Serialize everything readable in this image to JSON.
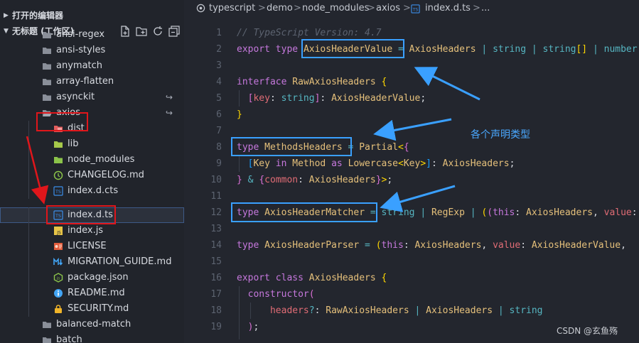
{
  "sidebar": {
    "open_editors_label": "打开的编辑器",
    "workspace_label": "无标题 (工作区)",
    "tree": [
      {
        "label": "ansi-regex",
        "kind": "folder",
        "badge": ""
      },
      {
        "label": "ansi-styles",
        "kind": "folder",
        "badge": ""
      },
      {
        "label": "anymatch",
        "kind": "folder",
        "badge": ""
      },
      {
        "label": "array-flatten",
        "kind": "folder",
        "badge": ""
      },
      {
        "label": "asynckit",
        "kind": "folder",
        "badge": "↪"
      },
      {
        "label": "axios",
        "kind": "folder-open",
        "badge": "↪"
      },
      {
        "label": "dist",
        "kind": "folder-red",
        "badge": ""
      },
      {
        "label": "lib",
        "kind": "folder-green",
        "badge": ""
      },
      {
        "label": "node_modules",
        "kind": "folder-green",
        "badge": ""
      },
      {
        "label": "CHANGELOG.md",
        "kind": "history",
        "badge": ""
      },
      {
        "label": "index.d.cts",
        "kind": "ts",
        "badge": ""
      },
      {
        "label": "index.d.ts",
        "kind": "ts",
        "badge": ""
      },
      {
        "label": "index.js",
        "kind": "js",
        "badge": ""
      },
      {
        "label": "LICENSE",
        "kind": "license",
        "badge": ""
      },
      {
        "label": "MIGRATION_GUIDE.md",
        "kind": "markdown",
        "badge": ""
      },
      {
        "label": "package.json",
        "kind": "nodejs",
        "badge": ""
      },
      {
        "label": "README.md",
        "kind": "info",
        "badge": ""
      },
      {
        "label": "SECURITY.md",
        "kind": "lock",
        "badge": ""
      },
      {
        "label": "balanced-match",
        "kind": "folder",
        "badge": ""
      },
      {
        "label": "batch",
        "kind": "folder",
        "badge": ""
      }
    ]
  },
  "breadcrumb": {
    "items": [
      "typescript",
      ">",
      "demo",
      ">",
      "node_modules",
      ">",
      "axios",
      ">",
      "index.d.ts",
      ">",
      "..."
    ]
  },
  "editor": {
    "line_numbers": [
      "1",
      "2",
      "3",
      "4",
      "5",
      "6",
      "7",
      "8",
      "9",
      "10",
      "11",
      "12",
      "13",
      "14",
      "15",
      "16",
      "17",
      "18",
      "19"
    ]
  },
  "annotation_text": "各个声明类型",
  "watermark": "CSDN @玄鱼殇",
  "colors": {
    "accent_blue": "#3aa0ff",
    "highlight_red": "#e0161b",
    "keyword": "#c678dd",
    "type": "#e5c07b"
  }
}
